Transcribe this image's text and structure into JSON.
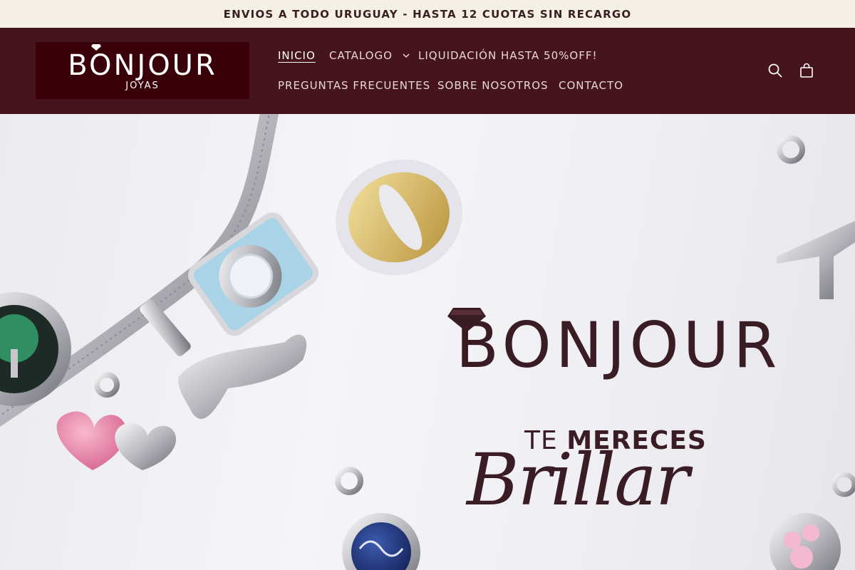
{
  "announcement": {
    "text": "ENVIOS A TODO URUGUAY - HASTA 12 CUOTAS SIN RECARGO"
  },
  "header": {
    "logo": {
      "word": "BONJOUR",
      "sub": "JOYAS"
    },
    "nav": [
      {
        "label": "INICIO",
        "active": true
      },
      {
        "label": "CATALOGO",
        "has_dropdown": true
      },
      {
        "label": "LIQUIDACIÓN HASTA 50%OFF!"
      },
      {
        "label": "PREGUNTAS FRECUENTES"
      },
      {
        "label": "SOBRE NOSOTROS"
      },
      {
        "label": "CONTACTO"
      }
    ],
    "icons": {
      "search": "search-icon",
      "cart": "cart-icon"
    }
  },
  "hero": {
    "brand": "BONJOUR",
    "tag_light": "TE ",
    "tag_bold": "MERECES",
    "script": "Brillar"
  },
  "colors": {
    "announcement_bg": "#f4f0e6",
    "header_bg": "#45141c",
    "logo_bg": "#3a0009",
    "brand_text": "#3a1c24"
  }
}
